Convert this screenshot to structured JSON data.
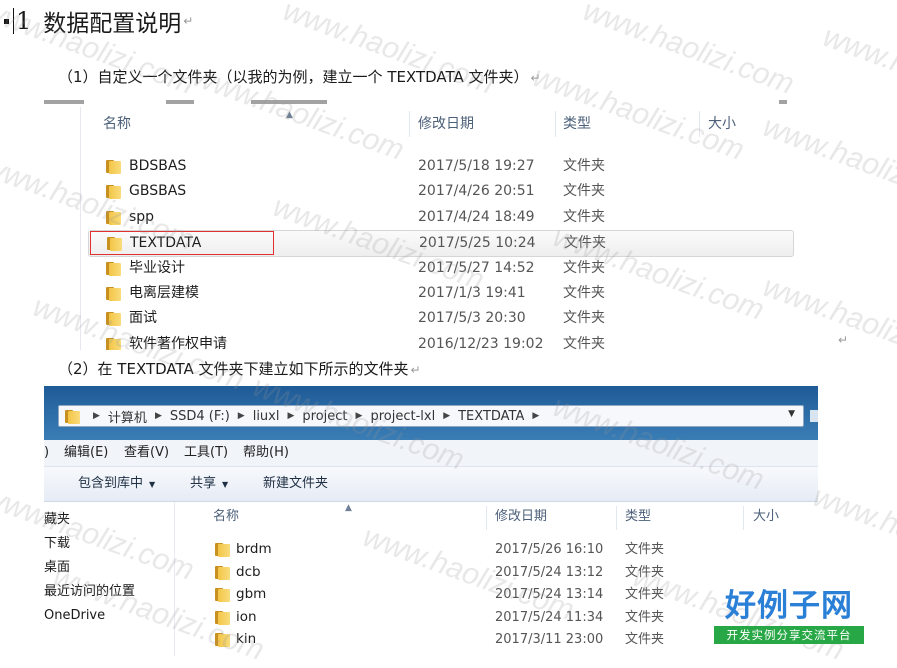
{
  "heading": {
    "number": "1",
    "title": "数据配置说明"
  },
  "para1": "（1）自定义一个文件夹（以我的为例，建立一个 TEXTDATA 文件夹）",
  "para2": "（2）在 TEXTDATA 文件夹下建立如下所示的文件夹",
  "explorer1": {
    "columns": {
      "name": "名称",
      "date": "修改日期",
      "type": "类型",
      "size": "大小"
    },
    "rows": [
      {
        "name": "BDSBAS",
        "date": "2017/5/18 19:27",
        "type": "文件夹"
      },
      {
        "name": "GBSBAS",
        "date": "2017/4/26 20:51",
        "type": "文件夹"
      },
      {
        "name": "spp",
        "date": "2017/4/24 18:49",
        "type": "文件夹"
      },
      {
        "name": "TEXTDATA",
        "date": "2017/5/25 10:24",
        "type": "文件夹"
      },
      {
        "name": "毕业设计",
        "date": "2017/5/27 14:52",
        "type": "文件夹"
      },
      {
        "name": "电离层建模",
        "date": "2017/1/3 19:41",
        "type": "文件夹"
      },
      {
        "name": "面试",
        "date": "2017/5/3 20:30",
        "type": "文件夹"
      },
      {
        "name": "软件著作权申请",
        "date": "2016/12/23 19:02",
        "type": "文件夹"
      }
    ]
  },
  "explorer2": {
    "breadcrumb": [
      "计算机",
      "SSD4 (F:)",
      "liuxl",
      "project",
      "project-lxl",
      "TEXTDATA"
    ],
    "menus": [
      ")",
      "编辑(E)",
      "查看(V)",
      "工具(T)",
      "帮助(H)"
    ],
    "toolbar": {
      "include": "包含到库中",
      "share": "共享",
      "new_folder": "新建文件夹"
    },
    "nav": [
      "藏夹",
      "下载",
      "桌面",
      "最近访问的位置",
      "OneDrive"
    ],
    "columns": {
      "name": "名称",
      "date": "修改日期",
      "type": "类型",
      "size": "大小"
    },
    "rows": [
      {
        "name": "brdm",
        "date": "2017/5/26 16:10",
        "type": "文件夹"
      },
      {
        "name": "dcb",
        "date": "2017/5/24 13:12",
        "type": "文件夹"
      },
      {
        "name": "gbm",
        "date": "2017/5/24 13:14",
        "type": "文件夹"
      },
      {
        "name": "ion",
        "date": "2017/5/24 11:34",
        "type": "文件夹"
      },
      {
        "name": "kin",
        "date": "2017/3/11 23:00",
        "type": "文件夹"
      }
    ]
  },
  "watermark": "www.haolizi.com",
  "logo": {
    "main": "好例子网",
    "sub": "开发实例分享交流平台"
  },
  "colors": {
    "highlight_border": "#e03030",
    "address_bar": "#2e6ea8",
    "logo_blue": "#2a7fd6",
    "logo_green": "#27a745"
  }
}
